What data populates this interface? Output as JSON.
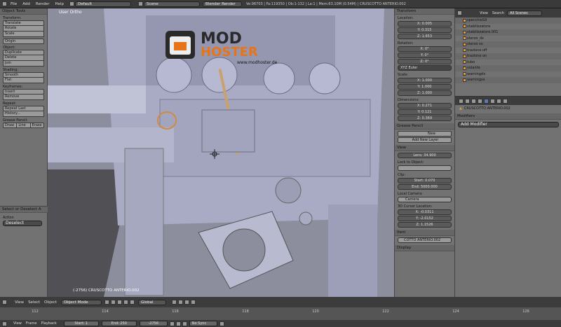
{
  "topbar": {
    "menus": [
      "File",
      "Add",
      "Render",
      "Help"
    ],
    "layout": "Default",
    "scene": "Scene",
    "engine": "Blender Render",
    "stats": "Ve:96703 | Fa:119350 | Ob:1-132 | La:1 | Mem:63.10M (0.54M) | CRUSCOTTO ANTERIO.002"
  },
  "toolshelf": {
    "title": "Object Tools",
    "transform_label": "Transform:",
    "transform": [
      "Translate",
      "Rotate",
      "Scale"
    ],
    "origin": "Origin",
    "object_label": "Object:",
    "object": [
      "Duplicate",
      "Delete",
      "Join"
    ],
    "shading_label": "Shading:",
    "shading": [
      "Smooth",
      "Flat"
    ],
    "keyframes_label": "Keyframes:",
    "keyframes": [
      "Insert",
      "Remove"
    ],
    "repeat_label": "Repeat:",
    "repeat": [
      "Repeat Last",
      "History..."
    ],
    "grease_label": "Grease Pencil:",
    "grease": [
      "Draw",
      "Line",
      "Erase"
    ],
    "op_title": "Select or Deselect A",
    "action_label": "Action",
    "action_value": "Deselect"
  },
  "viewport": {
    "view_name": "User Ortho",
    "object_label": "(-2756) CRUSCOTTO ANTERIO.002",
    "watermark_top": "MOD",
    "watermark_bottom": "HOSTER",
    "watermark_url": "www.modhoster.de"
  },
  "properties": {
    "transform_title": "Transform",
    "location_label": "Location:",
    "location": [
      "X: 0.005",
      "Y: 0.315",
      "Z: 1.653"
    ],
    "rotation_label": "Rotation:",
    "rotation": [
      "X: 0°",
      "Y: 0°",
      "Z: 0°"
    ],
    "rotation_mode": "XYZ Euler",
    "scale_label": "Scale:",
    "scale": [
      "X: 1.000",
      "Y: 1.000",
      "Z: 1.000"
    ],
    "dimensions_label": "Dimensions:",
    "dimensions": [
      "X: 0.271",
      "Y: 0.121",
      "Z: 0.369"
    ],
    "grease_title": "Grease Pencil",
    "grease_new": "New",
    "grease_add_layer": "Add New Layer",
    "view_title": "View",
    "lens": "Lens: 34.900",
    "lock_label": "Lock to Object:",
    "clip_label": "Clip:",
    "clip_start": "Start: 0.070",
    "clip_end": "End: 5000.000",
    "local_camera_label": "Local Camera:",
    "camera": "Camera",
    "cursor_label": "3D Cursor Location:",
    "cursor": [
      "X: -0.0311",
      "Y: -2.0152",
      "Z: 1.1526"
    ],
    "item_title": "Item",
    "item_name": "COTTO ANTERIO.002",
    "display_title": "Display"
  },
  "outliner": {
    "view_label": "View",
    "search_label": "Search",
    "scenes": "All Scenes",
    "items": [
      "specchioSX",
      "stabilizzatore",
      "stabilizzatore.001",
      "sterzo_dx",
      "sterzo sx",
      "trazione off",
      "trazione on",
      "tubo",
      "volante",
      "warningdx",
      "warningsx"
    ]
  },
  "modifiers": {
    "breadcrumb": "CRUSCOTTO ANTERIO.002",
    "title": "Modifiers",
    "add_label": "Add Modifier"
  },
  "viewheader": {
    "view": "View",
    "select": "Select",
    "object": "Object",
    "mode": "Object Mode",
    "orientation": "Global"
  },
  "timeline": {
    "ticks": [
      "112",
      "114",
      "116",
      "118",
      "120",
      "122",
      "124",
      "126"
    ],
    "view": "View",
    "frame": "Frame",
    "playback": "Playback",
    "start": "Start: 1",
    "end": "End: 250",
    "current": "-2756",
    "sync": "No Sync"
  }
}
